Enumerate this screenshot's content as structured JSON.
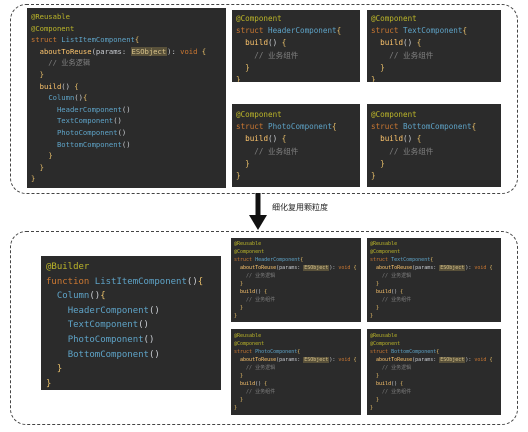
{
  "top_panels": {
    "list_item": [
      "@Reusable",
      "@Component",
      "struct ListItemComponent{",
      "  aboutToReuse(params: ESObject): void {",
      "    // 业务逻辑",
      "  }",
      "  build() {",
      "    Column(){",
      "      HeaderComponent()",
      "      TextComponent()",
      "      PhotoComponent()",
      "      BottomComponent()",
      "    }",
      "  }",
      "}"
    ],
    "header": [
      "@Component",
      "struct HeaderComponent{",
      "  build() {",
      "    // 业务组件",
      "  }",
      "}"
    ],
    "text": [
      "@Component",
      "struct TextComponent{",
      "  build() {",
      "    // 业务组件",
      "  }",
      "}"
    ],
    "photo": [
      "@Component",
      "struct PhotoComponent{",
      "  build() {",
      "    // 业务组件",
      "  }",
      "}"
    ],
    "bottom": [
      "@Component",
      "struct BottomComponent{",
      "  build() {",
      "    // 业务组件",
      "  }",
      "}"
    ]
  },
  "arrow_label": "细化复用颗粒度",
  "bottom_panels": {
    "builder": [
      "@Builder",
      "function ListItemComponent(){",
      "  Column(){",
      "    HeaderComponent()",
      "    TextComponent()",
      "    PhotoComponent()",
      "    BottomComponent()",
      "  }",
      "}"
    ],
    "header": [
      "@Reusable",
      "@Component",
      "struct HeaderComponent{",
      "  aboutToReuse(params: ESObject): void {",
      "    // 业务逻辑",
      "  }",
      "  build() {",
      "    // 业务组件",
      "  }",
      "}"
    ],
    "text": [
      "@Reusable",
      "@Component",
      "struct TextComponent{",
      "  aboutToReuse(params: ESObject): void {",
      "    // 业务逻辑",
      "  }",
      "  build() {",
      "    // 业务组件",
      "  }",
      "}"
    ],
    "photo": [
      "@Reusable",
      "@Component",
      "struct PhotoComponent{",
      "  aboutToReuse(params: ESObject): void {",
      "    // 业务逻辑",
      "  }",
      "  build() {",
      "    // 业务组件",
      "  }",
      "}"
    ],
    "bottom": [
      "@Reusable",
      "@Component",
      "struct BottomComponent{",
      "  aboutToReuse(params: ESObject): void {",
      "    // 业务逻辑",
      "  }",
      "  build() {",
      "    // 业务组件",
      "  }",
      "}"
    ]
  },
  "colors": {
    "panel_bg": "#2b2b2b",
    "decorator": "#bbb529",
    "keyword": "#cc7832",
    "struct_name": "#5ea3c7",
    "comment": "#808080",
    "param_type_highlight": "#59513a"
  }
}
